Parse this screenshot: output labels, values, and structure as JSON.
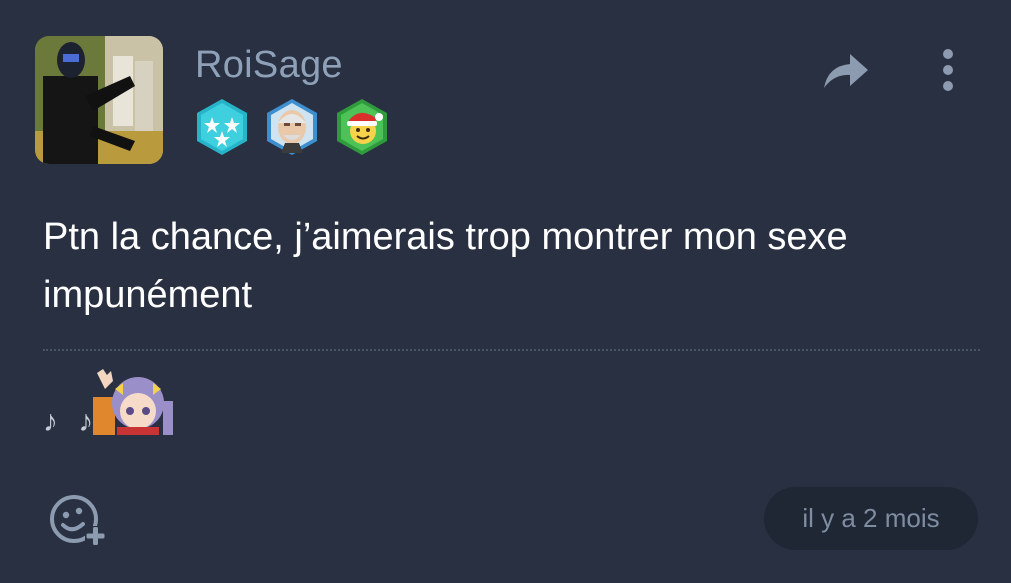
{
  "post": {
    "username": "RoiSage",
    "message": "Ptn la chance, j’aimerais trop montrer mon sexe impunément",
    "signature_text": "♪ ♪",
    "timestamp": "il y a 2 mois"
  },
  "badges": [
    {
      "icon": "stars-badge-icon",
      "color": "#2fc4d6"
    },
    {
      "icon": "harold-face-badge-icon",
      "color": "#4aa3e0"
    },
    {
      "icon": "santa-emoji-badge-icon",
      "color": "#3fae4a"
    }
  ],
  "icons": {
    "share": "share-arrow-icon",
    "more": "vertical-dots-icon",
    "react": "add-reaction-icon"
  },
  "colors": {
    "background": "#283041",
    "username": "#8fa1b8",
    "pill": "#1f2634",
    "muted": "#7e8da2"
  }
}
